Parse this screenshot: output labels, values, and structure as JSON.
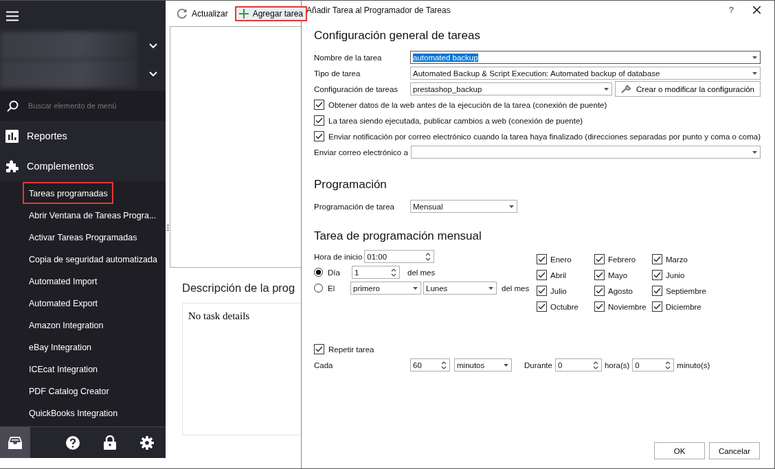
{
  "sidebar": {
    "selectors": [
      {
        "kind": "blurred"
      },
      {
        "kind": "blurred"
      }
    ],
    "search": {
      "placeholder": "Buscar elemento de menú"
    },
    "sections": [
      {
        "label": "Reportes",
        "kind": "chart"
      },
      {
        "label": "Complementos",
        "kind": "puzzle"
      }
    ],
    "items": [
      {
        "label": "Tareas programadas",
        "highlighted": true
      },
      {
        "label": "Abrir Ventana de Tareas Progra...",
        "highlighted": false
      },
      {
        "label": "Activar Tareas Programadas",
        "highlighted": false
      },
      {
        "label": "Copia de seguridad automatizada",
        "highlighted": false
      },
      {
        "label": "Automated Import",
        "highlighted": false
      },
      {
        "label": "Automated Export",
        "highlighted": false
      },
      {
        "label": "Amazon Integration",
        "highlighted": false
      },
      {
        "label": "eBay Integration",
        "highlighted": false
      },
      {
        "label": "ICEcat Integration",
        "highlighted": false
      },
      {
        "label": "PDF Catalog Creator",
        "highlighted": false
      },
      {
        "label": "QuickBooks Integration",
        "highlighted": false
      }
    ],
    "footer": [
      {
        "kind": "inbox",
        "selected": true
      },
      {
        "kind": "help",
        "selected": false
      },
      {
        "kind": "lock",
        "selected": false
      },
      {
        "kind": "settings",
        "selected": false
      }
    ]
  },
  "toolbar": [
    {
      "label": "Actualizar",
      "kind": "refresh",
      "highlighted": false
    },
    {
      "label": "Agregar tarea",
      "kind": "add",
      "highlighted": true
    }
  ],
  "description": {
    "title": "Descripción de la prog",
    "text": "No task details"
  },
  "dialog": {
    "title": "Añadir Tarea al Programador de Tareas",
    "help": "?",
    "general": {
      "heading": "Configuración general de tareas",
      "fields": [
        {
          "kind": "combo",
          "label": "Nombre de la tarea",
          "value": "automated backup",
          "text_selected": true
        },
        {
          "kind": "combo",
          "label": "Tipo de tarea",
          "value": "Automated Backup & Script Execution: Automated backup of database",
          "text_selected": false
        },
        {
          "kind": "combo-button",
          "label": "Configuración de tareas",
          "value": "prestashop_backup",
          "button": "Crear o modificar la configuración",
          "text_selected": false
        }
      ],
      "checks": [
        {
          "label": "Obtener datos de la web antes de la ejecución de la tarea (conexión de puente)",
          "checked": true
        },
        {
          "label": "La tarea siendo ejecutada, publicar cambios a web (conexión de puente)",
          "checked": true
        },
        {
          "label": "Enviar notificación por correo electrónico cuando la tarea haya finalizado (direcciones separadas por punto y coma o coma)",
          "checked": true
        }
      ],
      "email_label": "Enviar correo electrónico a"
    },
    "schedule": {
      "heading": "Programación",
      "label": "Programación de tarea",
      "value": "Mensual"
    },
    "monthly": {
      "heading": "Tarea de programación mensual",
      "start_label": "Hora de inicio",
      "start": "01:00",
      "options": [
        {
          "kind": "day",
          "label": "Día",
          "selected": true,
          "day": "1",
          "suffix": "del mes"
        },
        {
          "kind": "weekday",
          "label": "El",
          "selected": false,
          "ordinal": "primero",
          "weekday": "Lunes",
          "suffix": "del mes"
        }
      ],
      "months": [
        {
          "label": "Enero",
          "checked": true
        },
        {
          "label": "Febrero",
          "checked": true
        },
        {
          "label": "Marzo",
          "checked": true
        },
        {
          "label": "Abril",
          "checked": true
        },
        {
          "label": "Mayo",
          "checked": true
        },
        {
          "label": "Junio",
          "checked": true
        },
        {
          "label": "Julio",
          "checked": true
        },
        {
          "label": "Agosto",
          "checked": true
        },
        {
          "label": "Septiembre",
          "checked": true
        },
        {
          "label": "Octubre",
          "checked": true
        },
        {
          "label": "Noviembre",
          "checked": true
        },
        {
          "label": "Diciembre",
          "checked": true
        }
      ]
    },
    "repeat": {
      "label": "Repetir tarea",
      "checked": true,
      "every_label": "Cada",
      "every": "60",
      "unit": "minutos",
      "for_label": "Durante",
      "hours": "0",
      "hours_unit": "hora(s)",
      "minutes": "0",
      "minutes_unit": "minuto(s)"
    },
    "buttons": [
      "OK",
      "Cancelar"
    ]
  }
}
